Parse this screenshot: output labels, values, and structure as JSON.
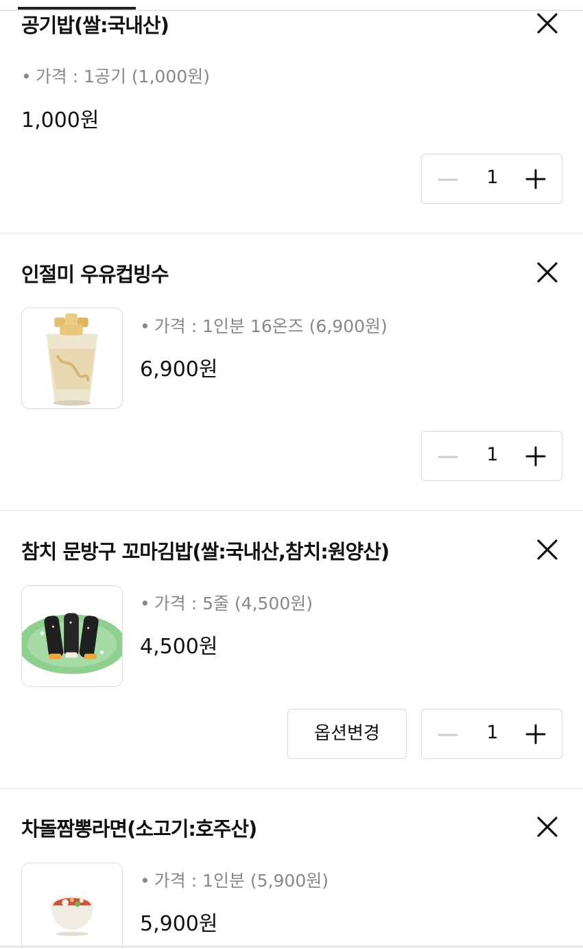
{
  "items": [
    {
      "name": "공기밥(쌀:국내산)",
      "price_desc": "가격 : 1공기 (1,000원)",
      "price": "1,000원",
      "quantity": "1"
    },
    {
      "name": "인절미 우유컵빙수",
      "price_desc": "가격 : 1인분 16온즈 (6,900원)",
      "price": "6,900원",
      "quantity": "1"
    },
    {
      "name": "참치 문방구 꼬마김밥(쌀:국내산,참치:원양산)",
      "price_desc": "가격 : 5줄 (4,500원)",
      "price": "4,500원",
      "quantity": "1",
      "option_label": "옵션변경"
    },
    {
      "name": "차돌짬뽕라면(소고기:호주산)",
      "price_desc": "가격 : 1인분 (5,900원)",
      "price": "5,900원"
    }
  ],
  "icons": {
    "remove": "close-icon",
    "decrease": "minus-icon",
    "increase": "plus-icon"
  },
  "colors": {
    "text": "#111111",
    "muted": "#888888",
    "border": "#d8d8d8",
    "disabled_minus": "#cccccc"
  }
}
